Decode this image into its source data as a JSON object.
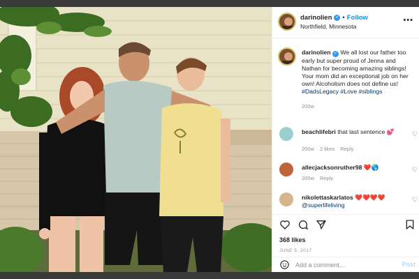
{
  "post": {
    "username": "darinolien",
    "follow_label": "Follow",
    "dot": "•",
    "location": "Northfield, Minnesota",
    "more_label": "•••"
  },
  "caption": {
    "username": "darinolien",
    "text": "We all lost our father too early but super proud of Jenna and Nathan for becoming amazing siblings! Your mom did an exceptional job on her own! Alcoholism does not define us!",
    "hashtags": "#DadsLegacy #Love #siblings",
    "time": "200w"
  },
  "comments": [
    {
      "username": "beachlifebri",
      "text": "that last sentence",
      "emoji": "💕",
      "time": "200w",
      "likes": "2 likes",
      "reply": "Reply"
    },
    {
      "username": "allecjacksonruther98",
      "text": "",
      "emoji": "❤️🌎",
      "time": "200w",
      "likes": "",
      "reply": "Reply"
    },
    {
      "username": "nikolettaskarlatos",
      "text": "",
      "emoji": "❤️❤️❤️❤️",
      "mention": "@superlifeliving",
      "time": "",
      "likes": "",
      "reply": ""
    }
  ],
  "engagement": {
    "likes": "368 likes",
    "date": "JUNE 5, 2017"
  },
  "add_comment": {
    "placeholder": "Add a comment...",
    "post_label": "Post"
  },
  "colors": {
    "accent": "#0095f6",
    "hashtag": "#00376b",
    "muted": "#8e8e8e",
    "post_disabled": "#b2dffc",
    "verified": "#3897f0"
  },
  "icons": [
    "verified-badge-icon",
    "more-options-icon",
    "heart-icon",
    "comment-icon",
    "share-icon",
    "bookmark-icon",
    "emoji-icon"
  ]
}
